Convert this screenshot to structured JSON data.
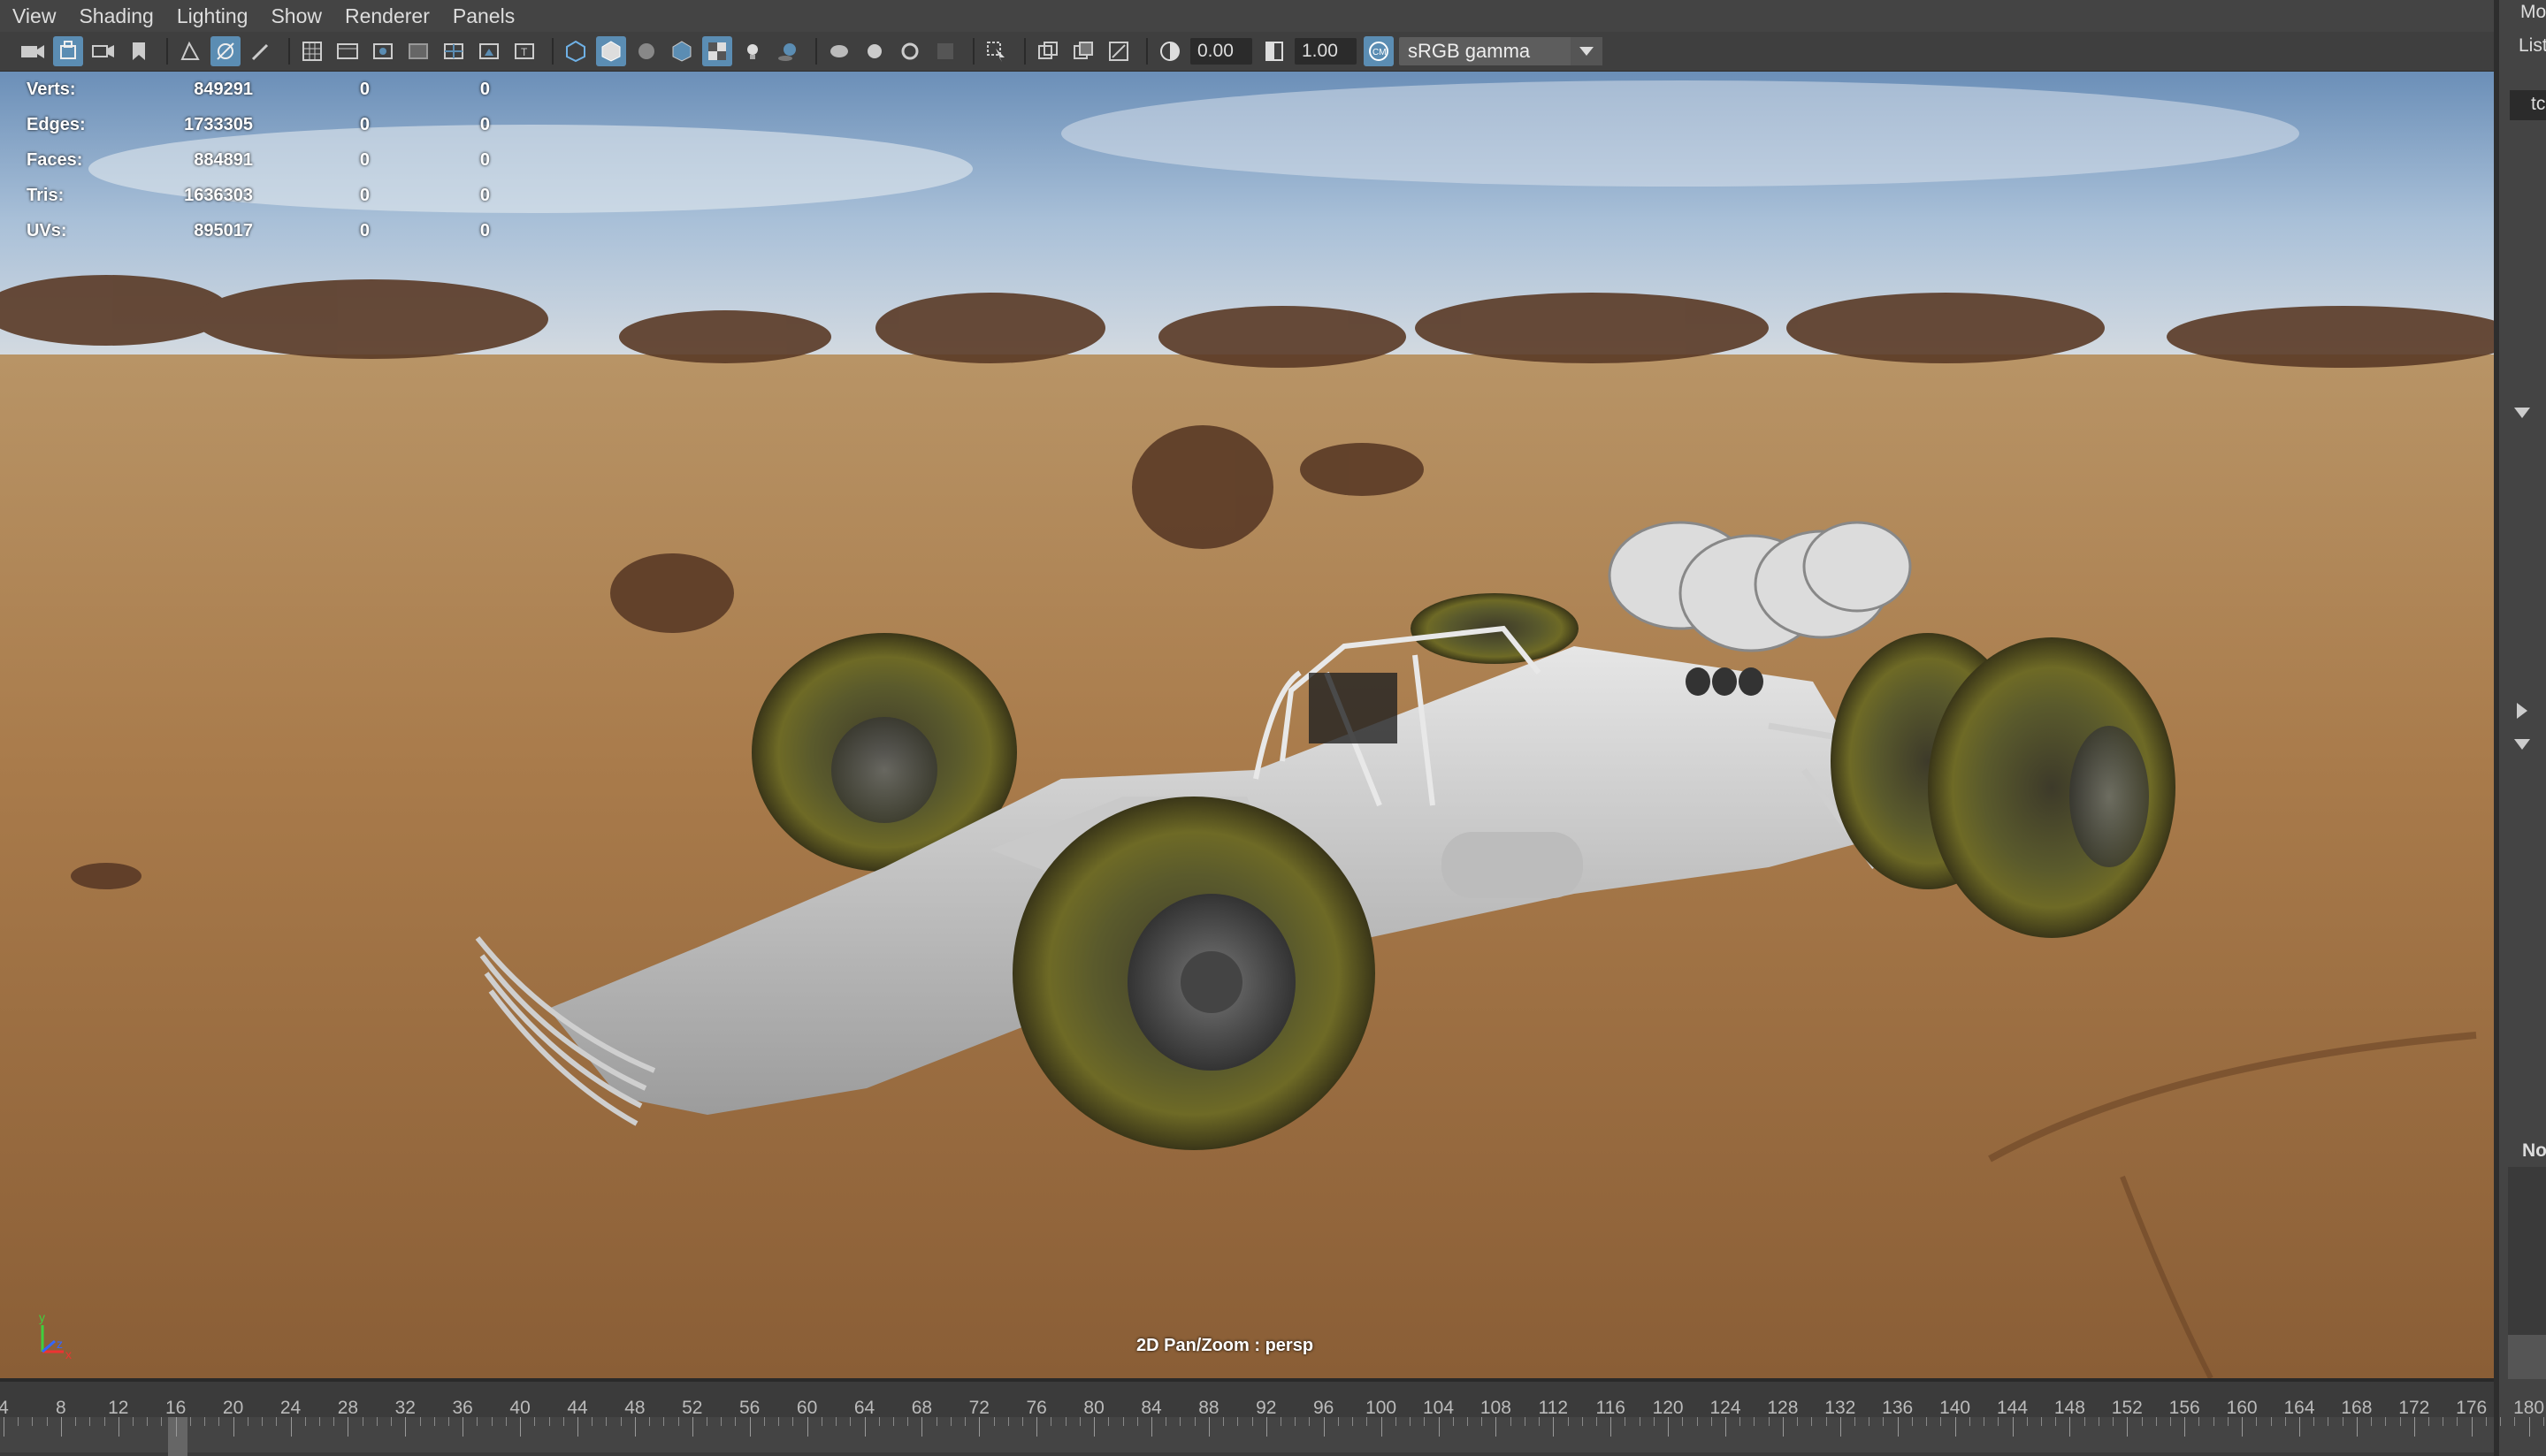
{
  "menu": [
    "View",
    "Shading",
    "Lighting",
    "Show",
    "Renderer",
    "Panels"
  ],
  "toolbar": {
    "exposure_value": "0.00",
    "gamma_value": "1.00",
    "colorspace": "sRGB gamma"
  },
  "hud": {
    "rows": [
      {
        "label": "Verts:",
        "v1": "849291",
        "v2": "0",
        "v3": "0"
      },
      {
        "label": "Edges:",
        "v1": "1733305",
        "v2": "0",
        "v3": "0"
      },
      {
        "label": "Faces:",
        "v1": "884891",
        "v2": "0",
        "v3": "0"
      },
      {
        "label": "Tris:",
        "v1": "1636303",
        "v2": "0",
        "v3": "0"
      },
      {
        "label": "UVs:",
        "v1": "895017",
        "v2": "0",
        "v3": "0"
      }
    ]
  },
  "viewport": {
    "camera_label": "2D Pan/Zoom : persp"
  },
  "right_panel": {
    "top_text": "Mo",
    "list_text": "List",
    "field_text": "tc",
    "bottom_text": "No"
  },
  "timeline": {
    "labels": [
      "4",
      "8",
      "12",
      "16",
      "20",
      "24",
      "28",
      "32",
      "36",
      "40",
      "44",
      "48",
      "52",
      "56",
      "60",
      "64",
      "68",
      "72",
      "76",
      "80",
      "84",
      "88",
      "92",
      "96",
      "100",
      "104",
      "108",
      "112",
      "116",
      "120",
      "124",
      "128",
      "132",
      "136",
      "140",
      "144",
      "148",
      "152",
      "156",
      "160",
      "164",
      "168",
      "172",
      "176",
      "180"
    ],
    "current_frame": "16"
  },
  "colors": {
    "ui_bg": "#444444",
    "accent": "#5b8db3"
  }
}
